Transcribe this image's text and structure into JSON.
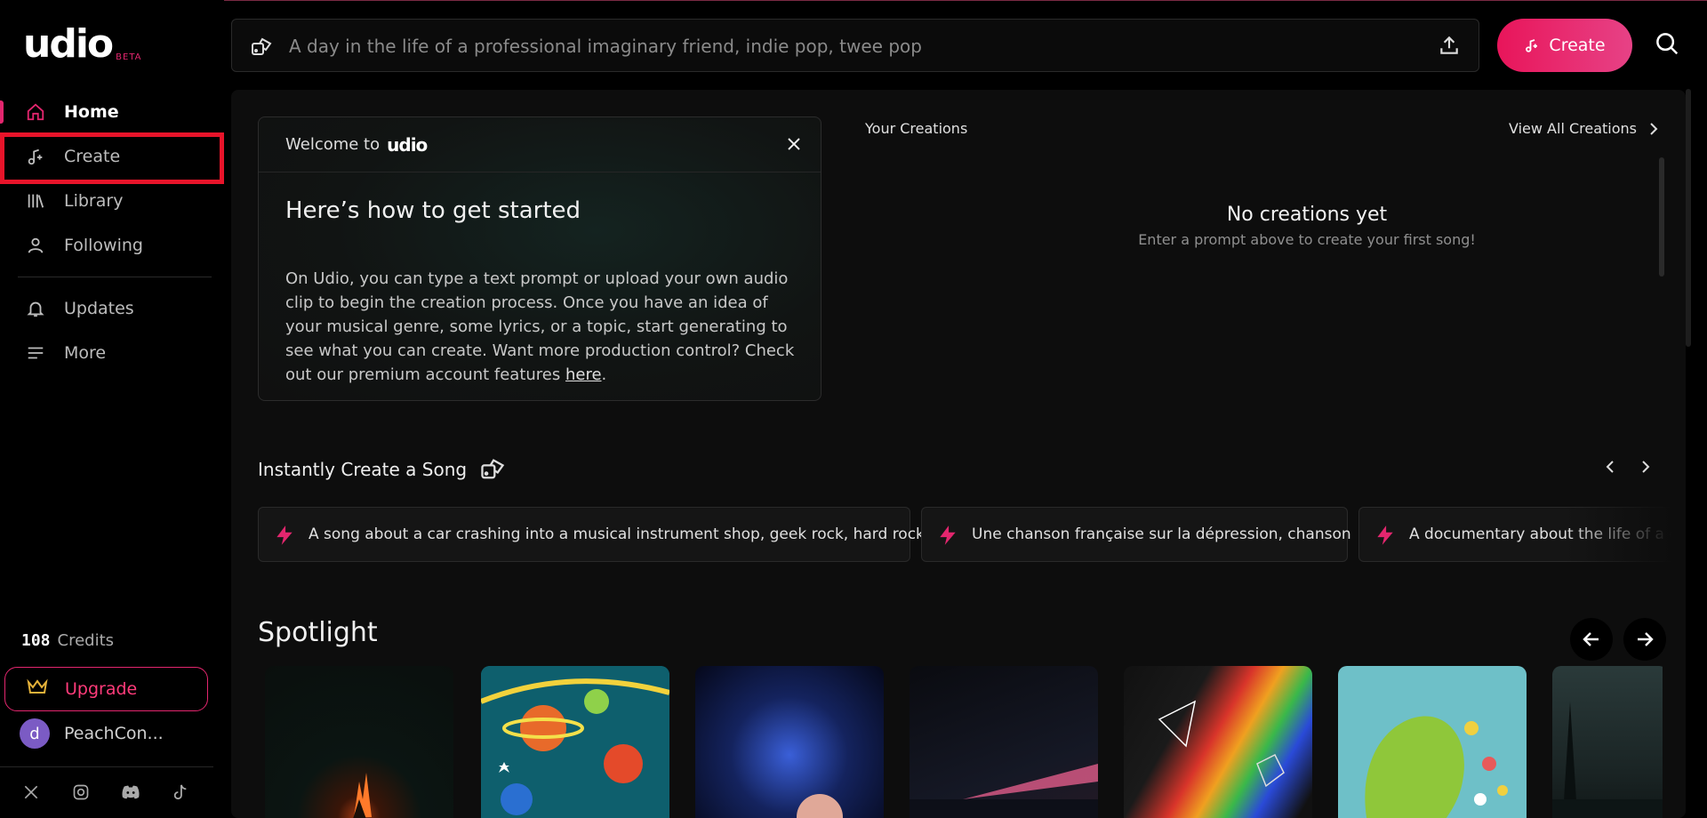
{
  "logo": {
    "word": "udio",
    "badge": "BETA"
  },
  "nav": {
    "items": [
      {
        "label": "Home",
        "icon": "home-icon"
      },
      {
        "label": "Create",
        "icon": "music-plus-icon"
      },
      {
        "label": "Library",
        "icon": "library-icon"
      },
      {
        "label": "Following",
        "icon": "user-icon"
      },
      {
        "label": "Updates",
        "icon": "bell-icon"
      },
      {
        "label": "More",
        "icon": "menu-icon"
      }
    ]
  },
  "sidebar": {
    "credits_count": "108",
    "credits_label": "Credits",
    "upgrade_label": "Upgrade",
    "user_initial": "d",
    "username": "PeachCon..."
  },
  "search": {
    "placeholder": "A day in the life of a professional imaginary friend, indie pop, twee pop"
  },
  "create_button": {
    "label": "Create"
  },
  "welcome": {
    "prefix": "Welcome to",
    "brand": "udio",
    "heading": "Here’s how to get started",
    "body": "On Udio, you can type a text prompt or upload your own audio clip to begin the creation process. Once you have an idea of your musical genre, some lyrics, or a topic, start generating to see what you can create. Want more production control? Check out our premium account features",
    "link": "here",
    "suffix": "."
  },
  "creations": {
    "title": "Your Creations",
    "view_all": "View All Creations",
    "empty_title": "No creations yet",
    "empty_subtitle": "Enter a prompt above to create your first song!"
  },
  "instant": {
    "title": "Instantly Create a Song",
    "prompts": [
      "A song about a car crashing into a musical instrument shop, geek rock, hard rock",
      "Une chanson française sur la dépression, chanson",
      "A documentary about the life of a c"
    ]
  },
  "spotlight": {
    "title": "Spotlight"
  },
  "colors": {
    "accent": "#e3266e",
    "highlight_box": "#e8142a",
    "background": "#0d0d0d"
  }
}
